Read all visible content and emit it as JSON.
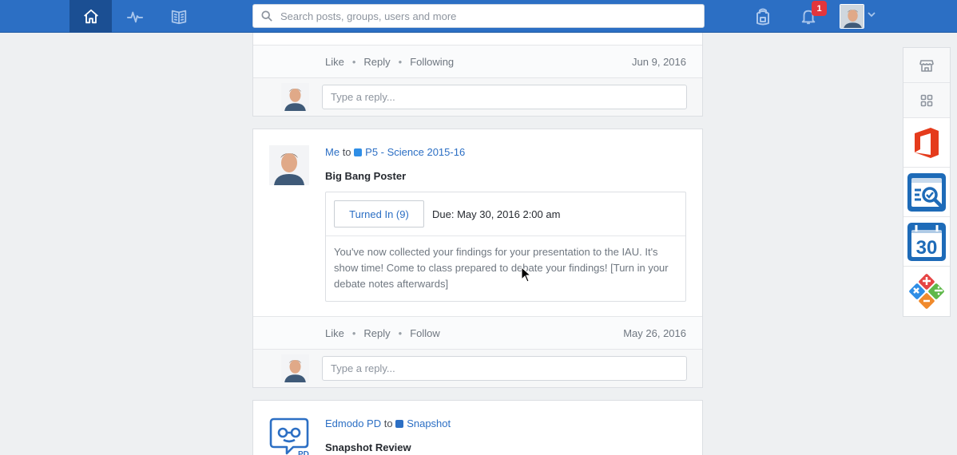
{
  "topbar": {
    "search_placeholder": "Search posts, groups, users and more",
    "notification_count": "1",
    "nav": [
      {
        "icon": "home-icon"
      },
      {
        "icon": "activity-pulse-icon"
      },
      {
        "icon": "book-icon"
      }
    ]
  },
  "feed": {
    "post_prev": {
      "actions": [
        "Like",
        "Reply",
        "Following"
      ],
      "date": "Jun 9, 2016",
      "reply_placeholder": "Type a reply..."
    },
    "post_assignment": {
      "author": "Me",
      "to": "to",
      "group": "P5 - Science 2015-16",
      "group_color": "#2f8ee6",
      "title": "Big Bang Poster",
      "turned_in_label": "Turned In (9)",
      "due": "Due: May 30, 2016 2:00 am",
      "description": "You've now collected your findings for your presentation to the IAU. It's show time! Come to class prepared to debate your findings! [Turn in your debate notes afterwards]",
      "actions": [
        "Like",
        "Reply",
        "Follow"
      ],
      "date": "May 26, 2016",
      "reply_placeholder": "Type a reply..."
    },
    "post_snapshot": {
      "author": "Edmodo PD",
      "to": "to",
      "group": "Snapshot",
      "group_color": "#2c6fc4",
      "title": "Snapshot Review",
      "avatar_label": "PD"
    }
  },
  "rail": {
    "items": [
      {
        "icon": "store-icon"
      },
      {
        "icon": "apps-grid-icon"
      }
    ],
    "apps": [
      {
        "name": "office-app-icon"
      },
      {
        "name": "quiz-review-app-icon"
      },
      {
        "name": "calendar-app-icon",
        "label": "30"
      },
      {
        "name": "math-operations-app-icon"
      }
    ]
  },
  "colors": {
    "topbar": "#2c6fc4",
    "link": "#2c6fc4",
    "badge": "#e3363c"
  }
}
